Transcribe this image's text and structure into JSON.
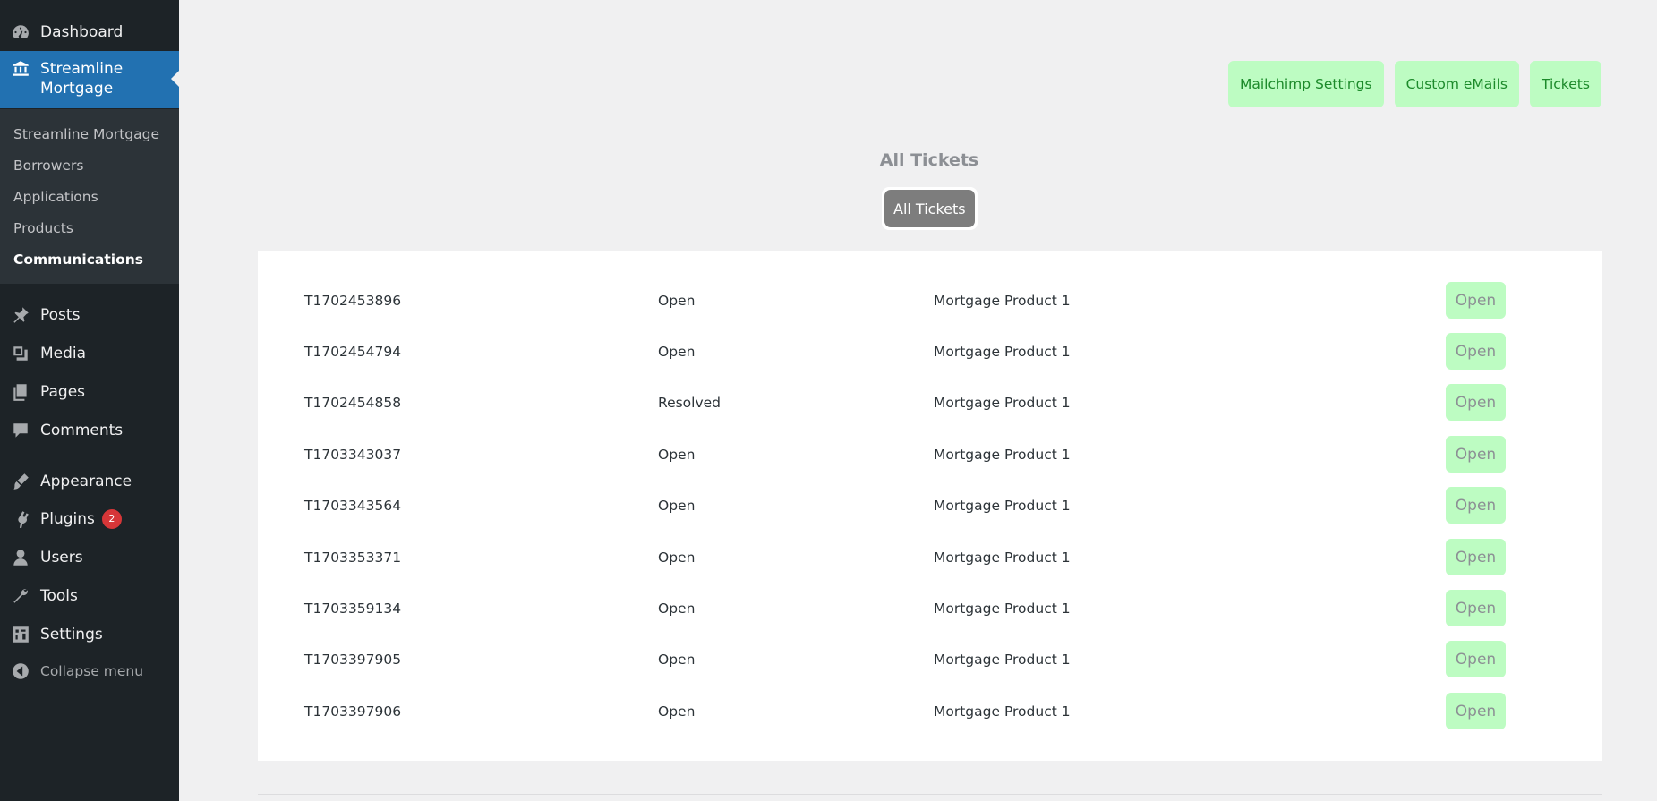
{
  "sidebar": {
    "dashboard": "Dashboard",
    "streamline": "Streamline Mortgage",
    "submenu": [
      "Streamline Mortgage",
      "Borrowers",
      "Applications",
      "Products",
      "Communications"
    ],
    "posts": "Posts",
    "media": "Media",
    "pages": "Pages",
    "comments": "Comments",
    "appearance": "Appearance",
    "plugins": "Plugins",
    "plugins_badge": "2",
    "users": "Users",
    "tools": "Tools",
    "settings": "Settings",
    "collapse": "Collapse menu"
  },
  "top_buttons": {
    "mailchimp": "Mailchimp Settings",
    "custom_emails": "Custom eMails",
    "tickets": "Tickets"
  },
  "page": {
    "title": "All Tickets",
    "filter_label": "All Tickets"
  },
  "tickets": [
    {
      "id": "T1702453896",
      "status": "Open",
      "product": "Mortgage Product 1",
      "action": "Open"
    },
    {
      "id": "T1702454794",
      "status": "Open",
      "product": "Mortgage Product 1",
      "action": "Open"
    },
    {
      "id": "T1702454858",
      "status": "Resolved",
      "product": "Mortgage Product 1",
      "action": "Open"
    },
    {
      "id": "T1703343037",
      "status": "Open",
      "product": "Mortgage Product 1",
      "action": "Open"
    },
    {
      "id": "T1703343564",
      "status": "Open",
      "product": "Mortgage Product 1",
      "action": "Open"
    },
    {
      "id": "T1703353371",
      "status": "Open",
      "product": "Mortgage Product 1",
      "action": "Open"
    },
    {
      "id": "T1703359134",
      "status": "Open",
      "product": "Mortgage Product 1",
      "action": "Open"
    },
    {
      "id": "T1703397905",
      "status": "Open",
      "product": "Mortgage Product 1",
      "action": "Open"
    },
    {
      "id": "T1703397906",
      "status": "Open",
      "product": "Mortgage Product 1",
      "action": "Open"
    }
  ]
}
